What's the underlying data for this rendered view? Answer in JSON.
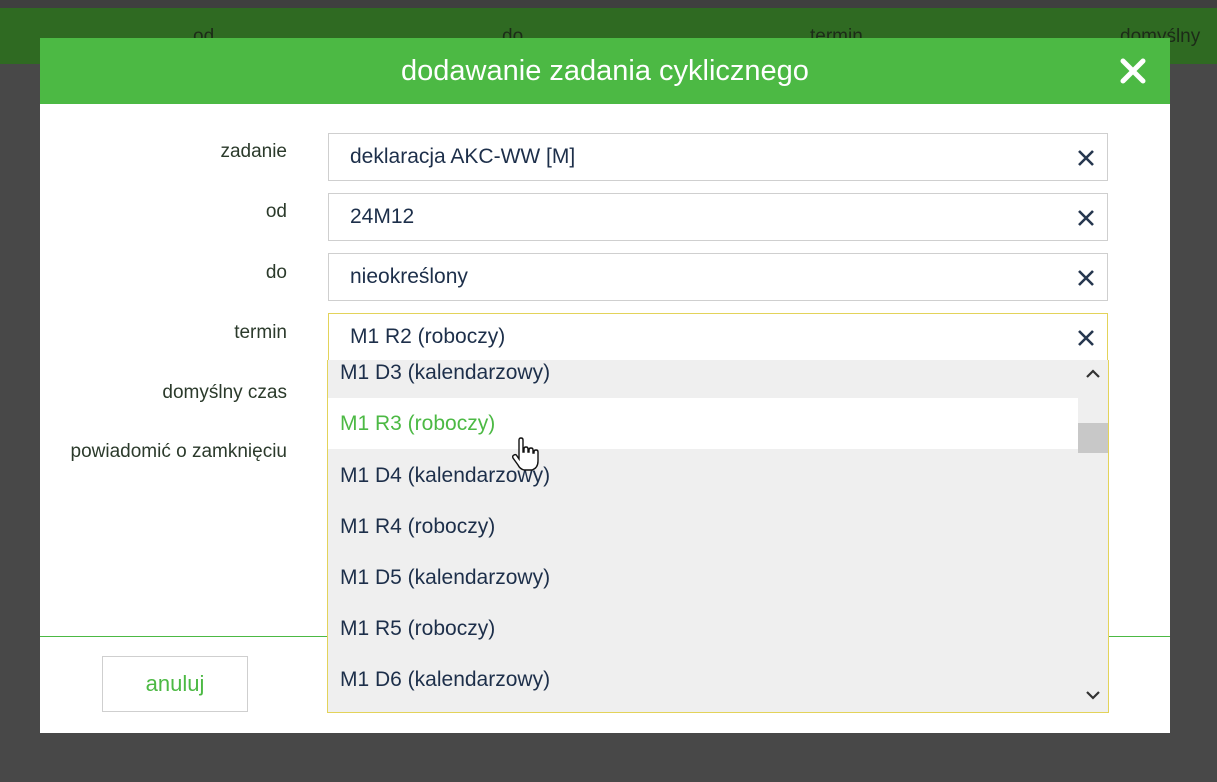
{
  "background": {
    "columns": [
      "od",
      "do",
      "termin",
      "domyślny"
    ]
  },
  "modal": {
    "title": "dodawanie zadania cyklicznego",
    "close_icon": "close-icon",
    "accent_color": "#4cb944",
    "fields": [
      {
        "label": "zadanie",
        "value": "deklaracja AKC-WW [M]"
      },
      {
        "label": "od",
        "value": "24M12"
      },
      {
        "label": "do",
        "value": "nieokreślony"
      },
      {
        "label": "termin",
        "value": "M1 R2 (roboczy)"
      }
    ],
    "extra_labels": [
      "domyślny czas",
      "powiadomić o zamknięciu"
    ],
    "cancel_label": "anuluj"
  },
  "dropdown": {
    "items": [
      "M1 D3 (kalendarzowy)",
      "M1 R3 (roboczy)",
      "M1 D4 (kalendarzowy)",
      "M1 R4 (roboczy)",
      "M1 D5 (kalendarzowy)",
      "M1 R5 (roboczy)",
      "M1 D6 (kalendarzowy)"
    ],
    "hovered_index": 1
  }
}
